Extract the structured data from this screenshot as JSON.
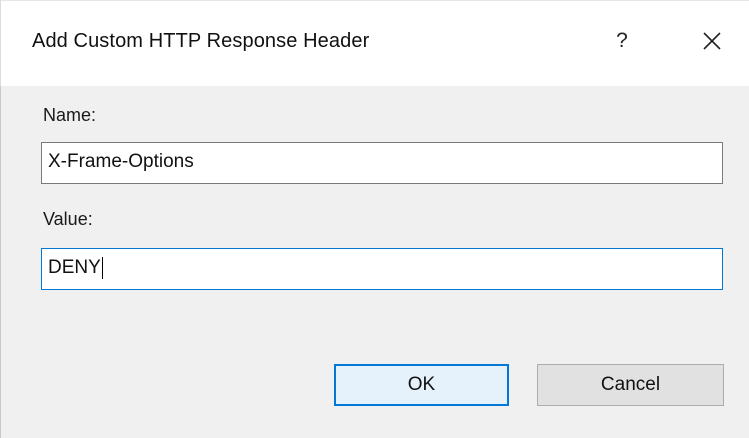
{
  "window": {
    "title": "Add Custom HTTP Response Header",
    "help_label": "?",
    "close_icon": "close-icon"
  },
  "form": {
    "name_label": "Name:",
    "name_value": "X-Frame-Options",
    "value_label": "Value:",
    "value_value": "DENY"
  },
  "buttons": {
    "ok_label": "OK",
    "cancel_label": "Cancel"
  },
  "colors": {
    "accent": "#0078d7",
    "dialog_background": "#f0f0f0",
    "titlebar_background": "#ffffff"
  }
}
